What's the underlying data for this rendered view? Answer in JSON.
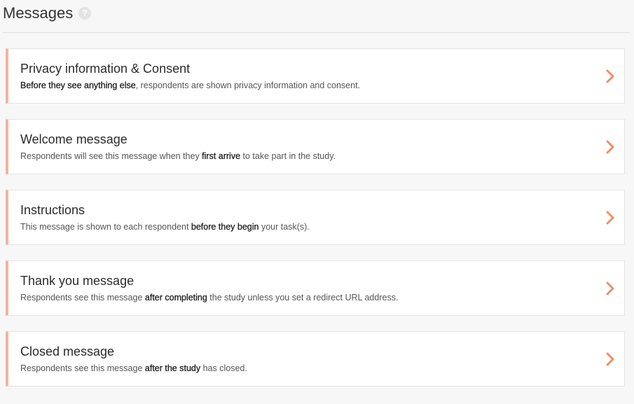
{
  "header": {
    "title": "Messages",
    "help_icon": "?"
  },
  "cards": [
    {
      "title": "Privacy information & Consent",
      "desc": [
        {
          "text": "Before they see anything else",
          "bold": true
        },
        {
          "text": ", respondents are shown privacy information and consent.",
          "bold": false
        }
      ]
    },
    {
      "title": "Welcome message",
      "desc": [
        {
          "text": "Respondents will see this message when they ",
          "bold": false
        },
        {
          "text": "first arrive",
          "bold": true
        },
        {
          "text": " to take part in the study.",
          "bold": false
        }
      ]
    },
    {
      "title": "Instructions",
      "desc": [
        {
          "text": "This message is shown to each respondent ",
          "bold": false
        },
        {
          "text": "before they begin",
          "bold": true
        },
        {
          "text": " your task(s).",
          "bold": false
        }
      ]
    },
    {
      "title": "Thank you message",
      "desc": [
        {
          "text": "Respondents see this message ",
          "bold": false
        },
        {
          "text": "after completing",
          "bold": true
        },
        {
          "text": " the study unless you set a redirect URL address.",
          "bold": false
        }
      ]
    },
    {
      "title": "Closed message",
      "desc": [
        {
          "text": "Respondents see this message ",
          "bold": false
        },
        {
          "text": "after the study",
          "bold": true
        },
        {
          "text": " has closed.",
          "bold": false
        }
      ]
    }
  ],
  "colors": {
    "accent": "#f3b49c",
    "chevron": "#ee8f68",
    "background": "#f7f7f7"
  },
  "icons": {
    "help": "help-icon",
    "chevron": "chevron-right-icon"
  }
}
